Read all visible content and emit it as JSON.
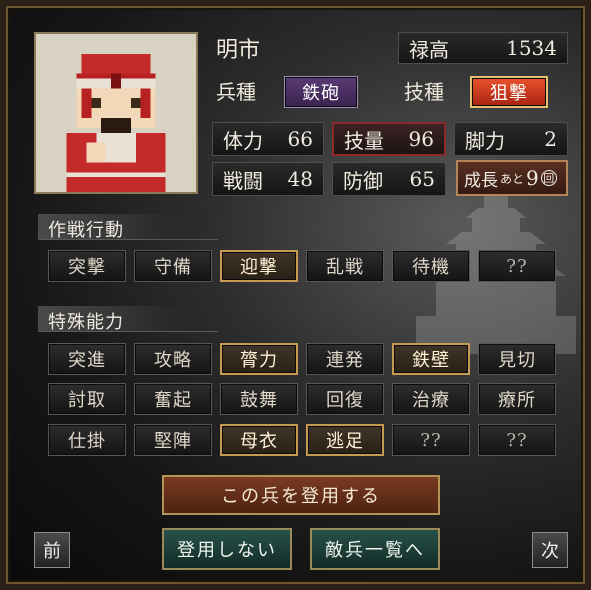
{
  "unit": {
    "name": "明市",
    "portrait": "pixel-soldier-red-headband",
    "troop_type_label": "兵種",
    "troop_type": "鉄砲",
    "skill_type_label": "技種",
    "skill_type": "狙撃",
    "stipend_label": "禄高",
    "stipend": "1534"
  },
  "stats": [
    {
      "label": "体力",
      "value": "66",
      "highlight": false
    },
    {
      "label": "技量",
      "value": "96",
      "highlight": true
    },
    {
      "label": "脚力",
      "value": "2",
      "highlight": false
    },
    {
      "label": "戦闘",
      "value": "48",
      "highlight": false
    },
    {
      "label": "防御",
      "value": "65",
      "highlight": false
    }
  ],
  "growth": {
    "label": "成長",
    "sub": "あと",
    "value": "9",
    "unit": "回"
  },
  "tactics": {
    "title": "作戦行動",
    "items": [
      {
        "label": "突撃",
        "active": false
      },
      {
        "label": "守備",
        "active": false
      },
      {
        "label": "迎撃",
        "active": true
      },
      {
        "label": "乱戦",
        "active": false
      },
      {
        "label": "待機",
        "active": false
      },
      {
        "label": "??",
        "active": false
      }
    ]
  },
  "abilities": {
    "title": "特殊能力",
    "items": [
      {
        "label": "突進",
        "active": false
      },
      {
        "label": "攻略",
        "active": false
      },
      {
        "label": "膂力",
        "active": true
      },
      {
        "label": "連発",
        "active": false
      },
      {
        "label": "鉄壁",
        "active": true
      },
      {
        "label": "見切",
        "active": false
      },
      {
        "label": "討取",
        "active": false
      },
      {
        "label": "奮起",
        "active": false
      },
      {
        "label": "鼓舞",
        "active": false
      },
      {
        "label": "回復",
        "active": false
      },
      {
        "label": "治療",
        "active": false
      },
      {
        "label": "療所",
        "active": false
      },
      {
        "label": "仕掛",
        "active": false
      },
      {
        "label": "堅陣",
        "active": false
      },
      {
        "label": "母衣",
        "active": true
      },
      {
        "label": "逃足",
        "active": true
      },
      {
        "label": "??",
        "active": false
      },
      {
        "label": "??",
        "active": false
      }
    ]
  },
  "actions": {
    "recruit": "この兵を登用する",
    "decline": "登用しない",
    "enemy_list": "敵兵一覧へ",
    "prev": "前",
    "next": "次"
  },
  "colors": {
    "active_border": "#c79a52",
    "highlight_red": "#d33a22",
    "troop_purple": "#4a2f5e"
  }
}
